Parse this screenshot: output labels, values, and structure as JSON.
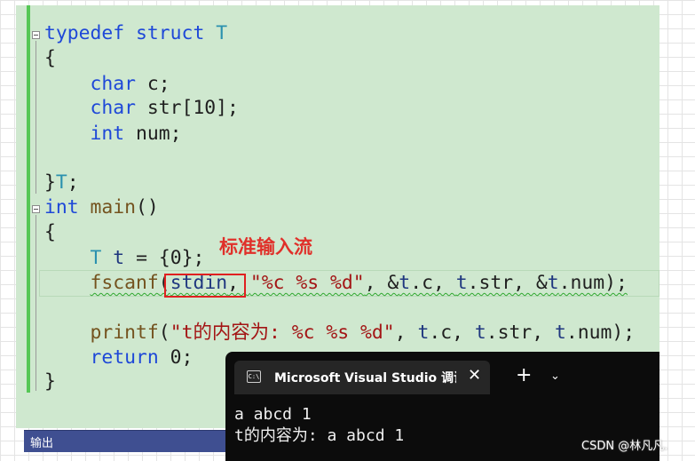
{
  "code": {
    "l1": {
      "kw1": "typedef",
      "kw2": "struct",
      "name": "T"
    },
    "l2": "{",
    "l3": {
      "kw": "char",
      "rest": " c;"
    },
    "l4": {
      "kw": "char",
      "rest": " str[10];"
    },
    "l5": {
      "kw": "int",
      "rest": " num;"
    },
    "l7": {
      "brace": "}",
      "name": "T",
      "semi": ";"
    },
    "l8": {
      "kw": "int",
      "fn": "main",
      "rest": "()"
    },
    "l9": "{",
    "l10": {
      "type": "T",
      "var": "t",
      "rest": " = {0};"
    },
    "l11": {
      "fn": "fscanf",
      "paren": "(",
      "arg1": "stdin",
      "comma1": ", ",
      "fmt": "\"%c %s %d\"",
      "p2": ", &",
      "v1": "t",
      "p3": ".c, ",
      "v2": "t",
      "p4": ".str, &",
      "v3": "t",
      "p5": ".num);"
    },
    "l13": {
      "fn": "printf",
      "paren": "(",
      "fmt": "\"t的内容为: %c %s %d\"",
      "p2": ", ",
      "v1": "t",
      "p3": ".c, ",
      "v2": "t",
      "p4": ".str, ",
      "v3": "t",
      "p5": ".num);"
    },
    "l14": {
      "kw": "return",
      "rest": " 0;"
    },
    "l15": "}"
  },
  "annotation": "标准输入流",
  "output_panel": {
    "label": "输出",
    "color": "#3f4f91"
  },
  "terminal": {
    "icon_text": "C:\\",
    "tab_title": "Microsoft Visual Studio 调试控制台",
    "close": "✕",
    "add": "+",
    "dropdown": "⌄",
    "lines": [
      "a abcd 1",
      "t的内容为: a abcd 1"
    ]
  },
  "watermark": "CSDN @林凡凡.",
  "colors": {
    "editor_bg": "#cfe8cf",
    "keyword": "#1e48d8",
    "type": "#2b91af",
    "highlight": "#e02020"
  }
}
